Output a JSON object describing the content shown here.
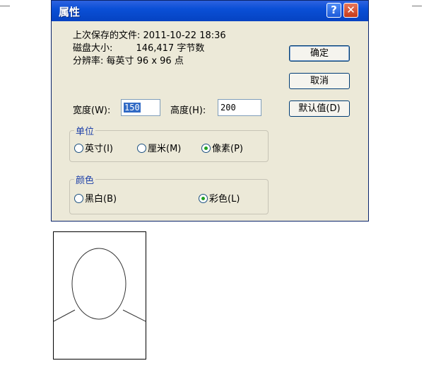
{
  "dialog": {
    "title": "属性",
    "help_glyph": "?",
    "close_glyph": "✕",
    "info": {
      "last_saved": "上次保存的文件: 2011-10-22 18:36",
      "disk_size": "磁盘大小:        146,417 字节数",
      "resolution": "分辨率: 每英寸 96 x 96 点"
    },
    "width_label": "宽度(W):",
    "width_value": "150",
    "height_label": "高度(H):",
    "height_value": "200",
    "unit_group": {
      "title": "单位",
      "options": [
        "英寸(I)",
        "厘米(M)",
        "像素(P)"
      ],
      "selected": "像素(P)"
    },
    "color_group": {
      "title": "颜色",
      "options": [
        "黑白(B)",
        "彩色(L)"
      ],
      "selected": "彩色(L)"
    },
    "buttons": {
      "ok": "确定",
      "cancel": "取消",
      "default": "默认值(D)"
    }
  },
  "accent_color": "#0a4fd6"
}
